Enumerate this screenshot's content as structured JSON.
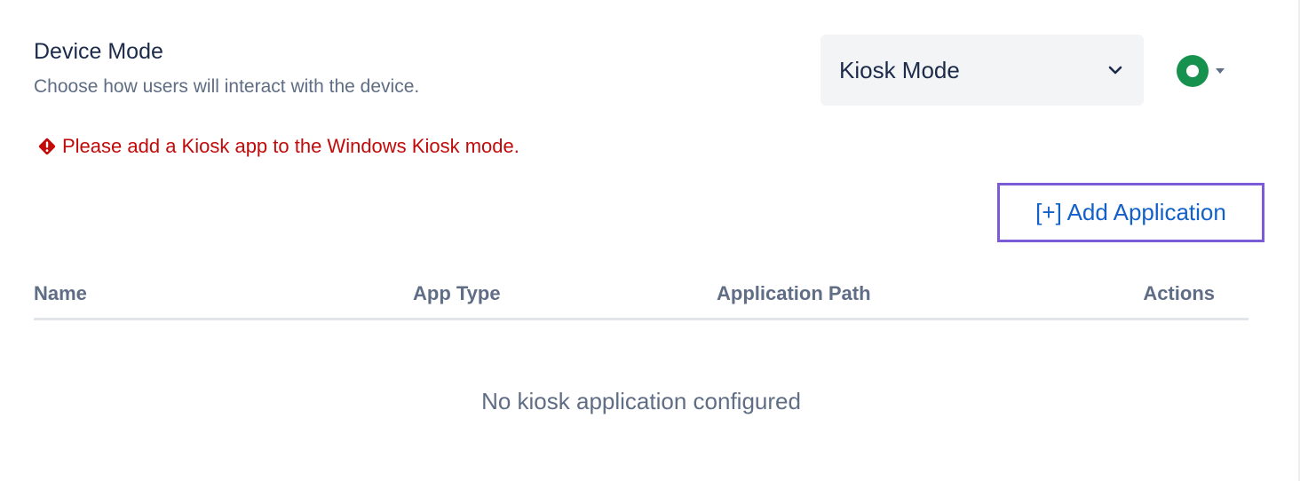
{
  "section": {
    "title": "Device Mode",
    "description": "Choose how users will interact with the device."
  },
  "mode_select": {
    "value": "Kiosk Mode",
    "icon": "chevron-down-icon"
  },
  "status": {
    "icon": "status-ring-icon",
    "color": "#16924e"
  },
  "warning": {
    "icon": "error-diamond-icon",
    "text": "Please add a Kiosk app to the Windows Kiosk mode.",
    "color": "#c10a0a"
  },
  "add_application": {
    "label": "[+] Add Application",
    "color": "#1260c9",
    "highlight_color": "#7b5bd6"
  },
  "table": {
    "columns": [
      "Name",
      "App Type",
      "Application Path",
      "Actions"
    ],
    "empty_message": "No kiosk application configured"
  }
}
